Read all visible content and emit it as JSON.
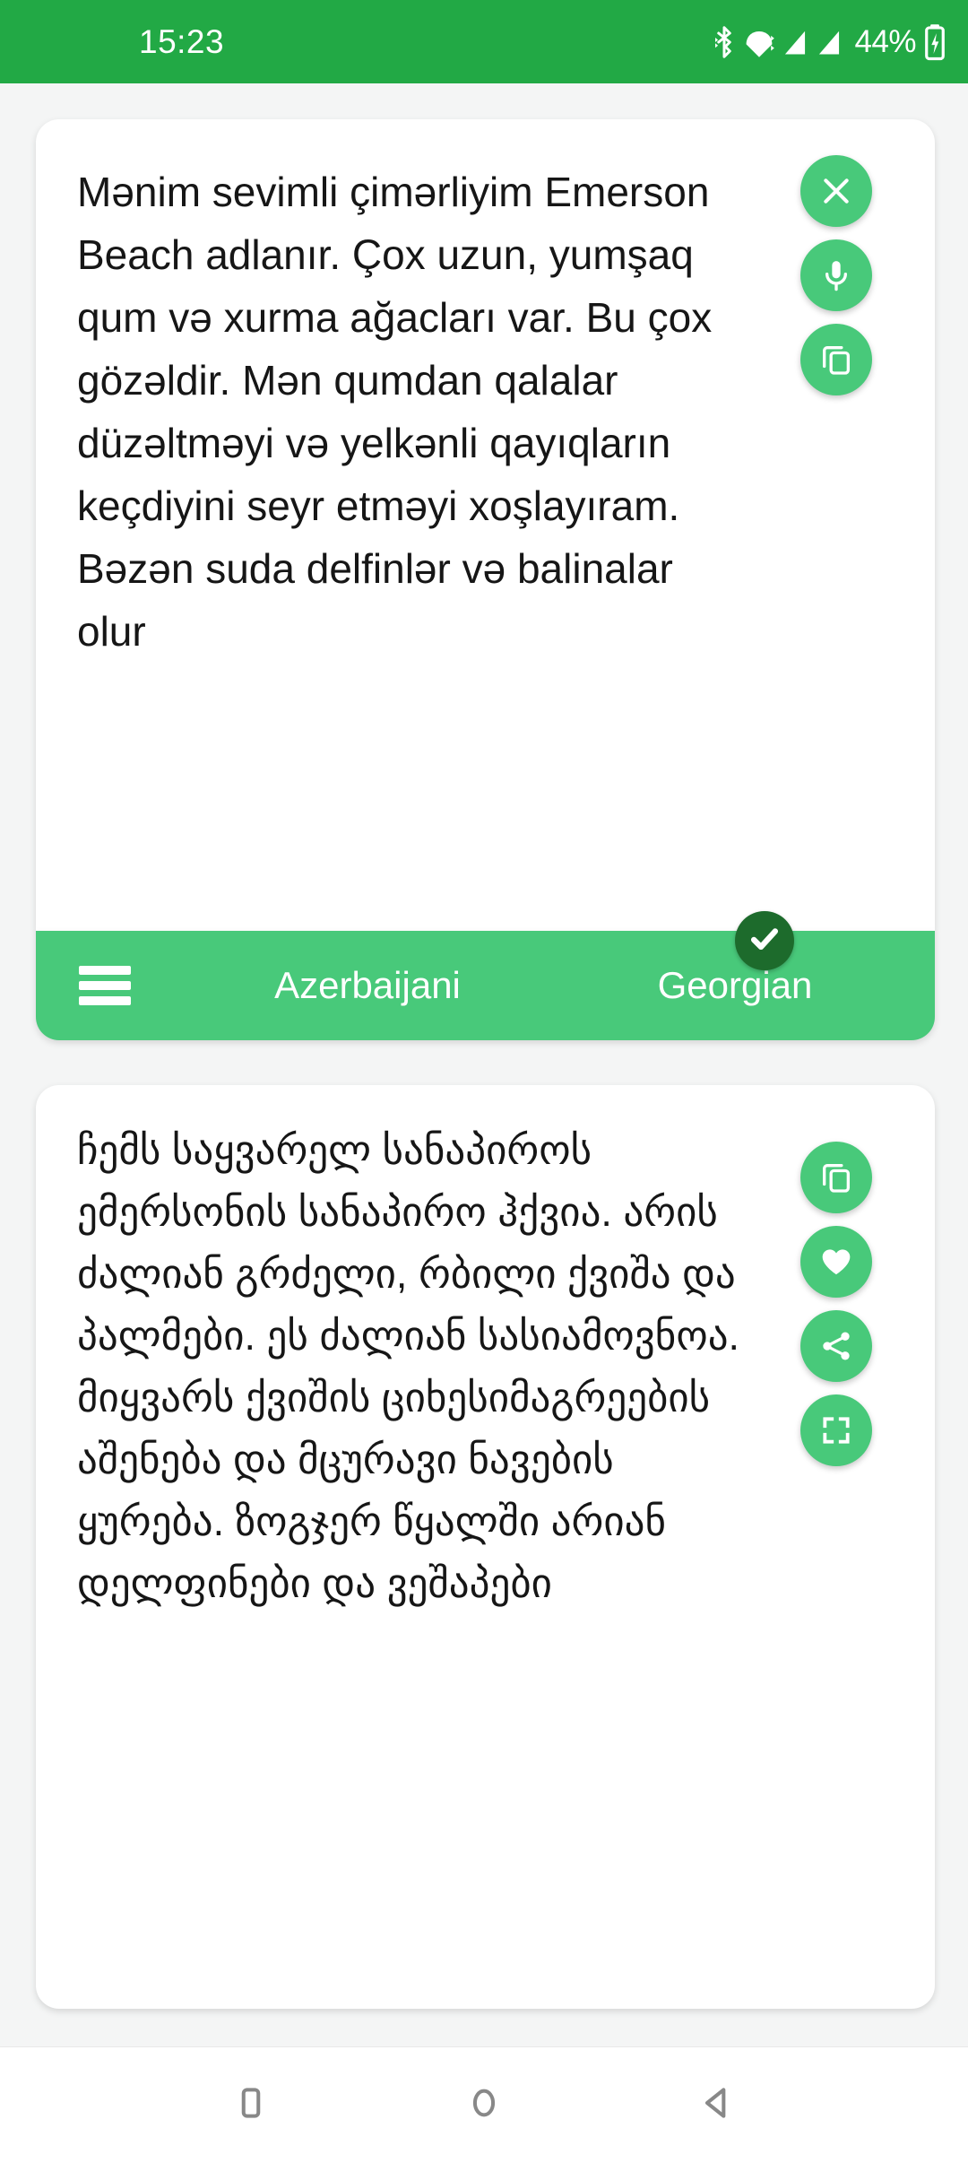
{
  "status_bar": {
    "time": "15:23",
    "battery_percent": "44%",
    "background_color": "#22a945",
    "icons": [
      "bluetooth-icon",
      "wifi-icon",
      "signal-icon",
      "signal-icon",
      "battery-charging-icon"
    ]
  },
  "theme": {
    "accent_green": "#48c97a",
    "status_green": "#22a945",
    "check_badge_green": "#1d6b2c",
    "page_background": "#f4f5f5",
    "card_background": "#ffffff",
    "text_color": "#161616"
  },
  "source_card": {
    "text": "Mənim sevimli çimərliyim Emerson Beach adlanır. Çox uzun, yumşaq qum və xurma ağacları var. Bu çox gözəldir. Mən qumdan qalalar düzəltməyi və yelkənli qayıqların keçdiyini seyr etməyi xoşlayıram. Bəzən suda delfinlər və balinalar olur",
    "actions": [
      {
        "name": "close-button",
        "icon": "close-icon"
      },
      {
        "name": "microphone-button",
        "icon": "microphone-icon"
      },
      {
        "name": "copy-button",
        "icon": "copy-icon"
      }
    ]
  },
  "language_bar": {
    "menu_label": "menu-icon",
    "source_language": "Azerbaijani",
    "target_language": "Georgian",
    "target_selected": true,
    "check_icon": "check-icon"
  },
  "target_card": {
    "text": "ჩემს საყვარელ სანაპიროს ემერსონის სანაპირო ჰქვია. არის ძალიან გრძელი, რბილი ქვიშა და პალმები. ეს ძალიან სასიამოვნოა. მიყვარს ქვიშის ციხესიმაგრეების აშენება და მცურავი ნავების ყურება. ზოგჯერ წყალში არიან დელფინები და ვეშაპები",
    "actions": [
      {
        "name": "copy-button",
        "icon": "copy-icon"
      },
      {
        "name": "favorite-button",
        "icon": "heart-icon"
      },
      {
        "name": "share-button",
        "icon": "share-icon"
      },
      {
        "name": "fullscreen-button",
        "icon": "fullscreen-icon"
      }
    ]
  },
  "navigation_bar": {
    "buttons": [
      {
        "name": "recents-button",
        "icon": "square-icon"
      },
      {
        "name": "home-button",
        "icon": "circle-icon"
      },
      {
        "name": "back-button",
        "icon": "triangle-back-icon"
      }
    ]
  }
}
